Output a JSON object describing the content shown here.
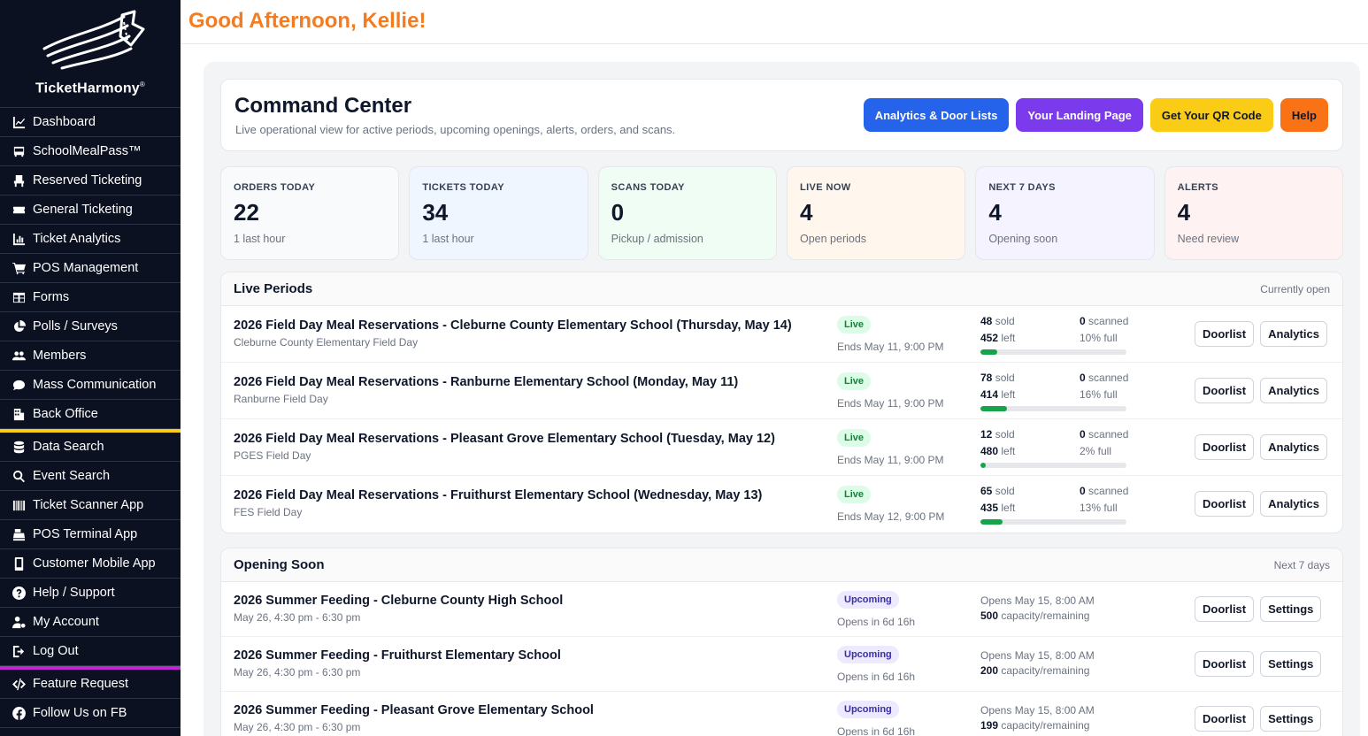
{
  "greeting": "Good Afternoon, Kellie!",
  "brand": {
    "name": "TicketHarmony",
    "mark": "®"
  },
  "sidebar": {
    "group1": [
      {
        "label": "Dashboard",
        "icon": "chart-line-icon"
      },
      {
        "label": "SchoolMealPass™",
        "icon": "school-bus-icon"
      },
      {
        "label": "Reserved Ticketing",
        "icon": "seat-icon"
      },
      {
        "label": "General Ticketing",
        "icon": "ticket-icon"
      },
      {
        "label": "Ticket Analytics",
        "icon": "bar-chart-icon"
      },
      {
        "label": "POS Management",
        "icon": "cart-icon"
      },
      {
        "label": "Forms",
        "icon": "table-icon"
      },
      {
        "label": "Polls / Surveys",
        "icon": "pie-chart-icon"
      },
      {
        "label": "Members",
        "icon": "users-icon"
      },
      {
        "label": "Mass Communication",
        "icon": "chat-icon"
      },
      {
        "label": "Back Office",
        "icon": "building-icon"
      }
    ],
    "group2": [
      {
        "label": "Data Search",
        "icon": "database-icon"
      },
      {
        "label": "Event Search",
        "icon": "search-icon"
      },
      {
        "label": "Ticket Scanner App",
        "icon": "barcode-icon"
      },
      {
        "label": "POS Terminal App",
        "icon": "cash-register-icon"
      },
      {
        "label": "Customer Mobile App",
        "icon": "mobile-icon"
      },
      {
        "label": "Help / Support",
        "icon": "help-icon"
      },
      {
        "label": "My Account",
        "icon": "user-gear-icon"
      },
      {
        "label": "Log Out",
        "icon": "logout-icon"
      }
    ],
    "group3": [
      {
        "label": "Feature Request",
        "icon": "code-icon"
      },
      {
        "label": "Follow Us on FB",
        "icon": "facebook-icon"
      }
    ]
  },
  "command_center": {
    "title": "Command Center",
    "subtitle": "Live operational view for active periods, upcoming openings, alerts, orders, and scans.",
    "buttons": [
      {
        "label": "Analytics & Door Lists",
        "bg": "#2563eb",
        "fg": "#ffffff"
      },
      {
        "label": "Your Landing Page",
        "bg": "#7c3aed",
        "fg": "#ffffff"
      },
      {
        "label": "Get Your QR Code",
        "bg": "#facc15",
        "fg": "#111827"
      },
      {
        "label": "Help",
        "bg": "#f97316",
        "fg": "#111827"
      }
    ]
  },
  "stats": [
    {
      "label": "ORDERS TODAY",
      "value": "22",
      "sub": "1 last hour",
      "bg": "#f8fafc"
    },
    {
      "label": "TICKETS TODAY",
      "value": "34",
      "sub": "1 last hour",
      "bg": "#eff6ff"
    },
    {
      "label": "SCANS TODAY",
      "value": "0",
      "sub": "Pickup / admission",
      "bg": "#f0fdf4"
    },
    {
      "label": "LIVE NOW",
      "value": "4",
      "sub": "Open periods",
      "bg": "#fff7ed"
    },
    {
      "label": "NEXT 7 DAYS",
      "value": "4",
      "sub": "Opening soon",
      "bg": "#f5f3ff"
    },
    {
      "label": "ALERTS",
      "value": "4",
      "sub": "Need review",
      "bg": "#fef2f2"
    }
  ],
  "live": {
    "title": "Live Periods",
    "note": "Currently open",
    "rows": [
      {
        "title": "2026 Field Day Meal Reservations - Cleburne County Elementary School (Thursday, May 14)",
        "sub": "Cleburne County Elementary Field Day",
        "status": "Live",
        "ends": "Ends May 11, 9:00 PM",
        "sold": "48",
        "sold_label": "sold",
        "left": "452",
        "left_label": "left",
        "scanned": "0",
        "scanned_label": "scanned",
        "full": "10% full",
        "pct": 0.1,
        "b1": "Doorlist",
        "b2": "Analytics"
      },
      {
        "title": "2026 Field Day Meal Reservations - Ranburne Elementary School (Monday, May 11)",
        "sub": "Ranburne Field Day",
        "status": "Live",
        "ends": "Ends May 11, 9:00 PM",
        "sold": "78",
        "sold_label": "sold",
        "left": "414",
        "left_label": "left",
        "scanned": "0",
        "scanned_label": "scanned",
        "full": "16% full",
        "pct": 0.16,
        "b1": "Doorlist",
        "b2": "Analytics"
      },
      {
        "title": "2026 Field Day Meal Reservations - Pleasant Grove Elementary School (Tuesday, May 12)",
        "sub": "PGES Field Day",
        "status": "Live",
        "ends": "Ends May 11, 9:00 PM",
        "sold": "12",
        "sold_label": "sold",
        "left": "480",
        "left_label": "left",
        "scanned": "0",
        "scanned_label": "scanned",
        "full": "2% full",
        "pct": 0.02,
        "b1": "Doorlist",
        "b2": "Analytics"
      },
      {
        "title": "2026 Field Day Meal Reservations - Fruithurst Elementary School (Wednesday, May 13)",
        "sub": "FES Field Day",
        "status": "Live",
        "ends": "Ends May 12, 9:00 PM",
        "sold": "65",
        "sold_label": "sold",
        "left": "435",
        "left_label": "left",
        "scanned": "0",
        "scanned_label": "scanned",
        "full": "13% full",
        "pct": 0.13,
        "b1": "Doorlist",
        "b2": "Analytics"
      }
    ]
  },
  "soon": {
    "title": "Opening Soon",
    "note": "Next 7 days",
    "rows": [
      {
        "title": "2026 Summer Feeding - Cleburne County High School",
        "sub": "May 26, 4:30 pm - 6:30 pm",
        "status": "Upcoming",
        "opens_in": "Opens in 6d 16h",
        "opens_at": "Opens May 15, 8:00 AM",
        "cap": "500",
        "cap_label": "capacity/remaining",
        "b1": "Doorlist",
        "b2": "Settings"
      },
      {
        "title": "2026 Summer Feeding - Fruithurst Elementary School",
        "sub": "May 26, 4:30 pm - 6:30 pm",
        "status": "Upcoming",
        "opens_in": "Opens in 6d 16h",
        "opens_at": "Opens May 15, 8:00 AM",
        "cap": "200",
        "cap_label": "capacity/remaining",
        "b1": "Doorlist",
        "b2": "Settings"
      },
      {
        "title": "2026 Summer Feeding - Pleasant Grove Elementary School",
        "sub": "May 26, 4:30 pm - 6:30 pm",
        "status": "Upcoming",
        "opens_in": "Opens in 6d 16h",
        "opens_at": "Opens May 15, 8:00 AM",
        "cap": "199",
        "cap_label": "capacity/remaining",
        "b1": "Doorlist",
        "b2": "Settings"
      }
    ]
  }
}
